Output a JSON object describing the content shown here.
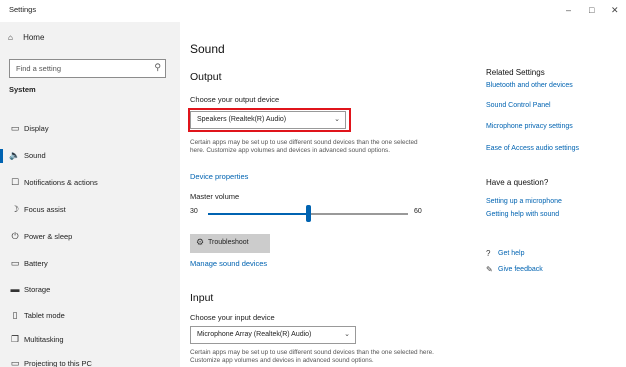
{
  "window": {
    "title": "Settings",
    "controls": {
      "minimize": "–",
      "maximize": "□",
      "close": "✕"
    }
  },
  "sidebar": {
    "back_label": "Home",
    "search_placeholder": "Find a setting",
    "section": "System",
    "items": [
      {
        "label": "Display",
        "icon": "monitor-icon",
        "glyph": "▭"
      },
      {
        "label": "Sound",
        "icon": "speaker-icon",
        "glyph": "🔈",
        "selected": true
      },
      {
        "label": "Notifications & actions",
        "icon": "notification-icon",
        "glyph": "☐"
      },
      {
        "label": "Focus assist",
        "icon": "moon-icon",
        "glyph": "☽"
      },
      {
        "label": "Power & sleep",
        "icon": "power-icon",
        "glyph": "⏻"
      },
      {
        "label": "Battery",
        "icon": "battery-icon",
        "glyph": "▭"
      },
      {
        "label": "Storage",
        "icon": "storage-icon",
        "glyph": "▬"
      },
      {
        "label": "Tablet mode",
        "icon": "tablet-icon",
        "glyph": "▯"
      },
      {
        "label": "Multitasking",
        "icon": "multitask-icon",
        "glyph": "❐"
      },
      {
        "label": "Projecting to this PC",
        "icon": "project-icon",
        "glyph": "▭"
      }
    ]
  },
  "main": {
    "page_title": "Sound",
    "output": {
      "heading": "Output",
      "device_label": "Choose your output device",
      "device_value": "Speakers (Realtek(R) Audio)",
      "description": "Certain apps may be set up to use different sound devices than the one selected here. Customize app volumes and devices in advanced sound options.",
      "properties_link": "Device properties",
      "volume_label": "Master volume",
      "volume_min": "30",
      "volume_max": "60",
      "volume_level": 0.5,
      "troubleshoot_label": "Troubleshoot",
      "manage_link": "Manage sound devices"
    },
    "input": {
      "heading": "Input",
      "device_label": "Choose your input device",
      "device_value": "Microphone Array (Realtek(R) Audio)",
      "description": "Certain apps may be set up to use different sound devices than the one selected here. Customize app volumes and devices in advanced sound options."
    }
  },
  "related": {
    "heading": "Related Settings",
    "links": [
      "Bluetooth and other devices",
      "Sound Control Panel",
      "Microphone privacy settings",
      "Ease of Access audio settings"
    ],
    "question_heading": "Have a question?",
    "question_links": [
      "Setting up a microphone",
      "Getting help with sound"
    ],
    "help": [
      {
        "label": "Get help",
        "icon": "help-icon",
        "glyph": "?"
      },
      {
        "label": "Give feedback",
        "icon": "feedback-icon",
        "glyph": "✎"
      }
    ]
  },
  "colors": {
    "accent": "#0063b1",
    "highlight_box": "#e0141b",
    "sidebar_bg": "#f2f2f2"
  }
}
